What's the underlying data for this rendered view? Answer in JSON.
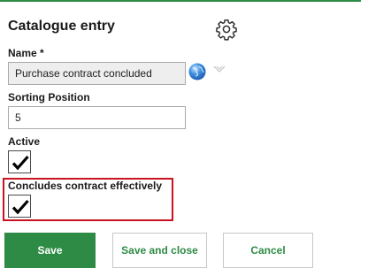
{
  "dialog": {
    "title": "Catalogue entry",
    "settings_icon": "gear-icon"
  },
  "fields": {
    "name": {
      "label": "Name *",
      "value": "Purchase contract concluded",
      "globe_icon": "globe-icon",
      "dropdown_icon": "chevron-down-icon"
    },
    "sorting_position": {
      "label": "Sorting Position",
      "value": "5"
    },
    "active": {
      "label": "Active",
      "checked": true
    },
    "concludes_contract": {
      "label": "Concludes contract effectively",
      "checked": true
    }
  },
  "buttons": {
    "save": "Save",
    "save_and_close": "Save and close",
    "cancel": "Cancel"
  },
  "colors": {
    "accent": "#2e8b45",
    "highlight": "#c8141e"
  }
}
